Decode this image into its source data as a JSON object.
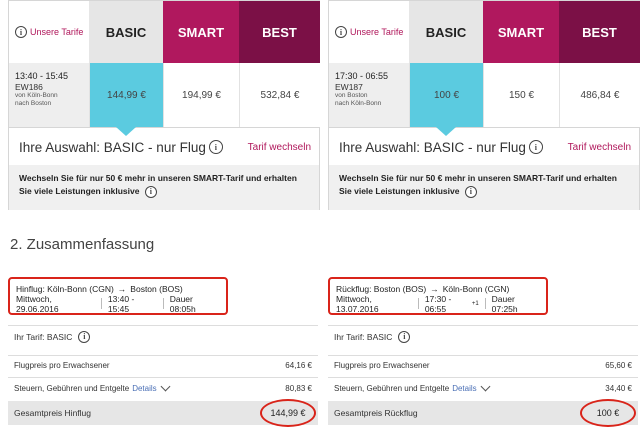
{
  "tariff_panels": [
    {
      "label": "Unsere Tarife",
      "tiers": [
        "BASIC",
        "SMART",
        "BEST"
      ],
      "flight_time": "13:40 - 15:45",
      "flight_number": "EW186",
      "route_line1": "von Köln-Bonn",
      "route_line2": "nach Boston",
      "prices": [
        "144,99 €",
        "194,99 €",
        "532,84 €"
      ],
      "selection": "Ihre Auswahl: BASIC - nur Flug",
      "change_link": "Tarif wechseln",
      "upsell": "Wechseln Sie für nur 50 € mehr in unseren SMART-Tarif und erhalten Sie viele Leistungen inklusive"
    },
    {
      "label": "Unsere Tarife",
      "tiers": [
        "BASIC",
        "SMART",
        "BEST"
      ],
      "flight_time": "17:30 - 06:55",
      "flight_number": "EW187",
      "route_line1": "von Boston",
      "route_line2": "nach Köln-Bonn",
      "prices": [
        "100 €",
        "150 €",
        "486,84 €"
      ],
      "selection": "Ihre Auswahl: BASIC - nur Flug",
      "change_link": "Tarif wechseln",
      "upsell": "Wechseln Sie für nur 50 € mehr in unseren SMART-Tarif und erhalten Sie viele Leistungen inklusive"
    }
  ],
  "section_title": "2. Zusammenfassung",
  "summaries": [
    {
      "route_prefix": "Hinflug: Köln-Bonn (CGN)",
      "arrow": "→",
      "destination": "Boston (BOS)",
      "date": "Mittwoch, 29.06.2016",
      "time": "13:40 - 15:45",
      "duration": "Dauer 08:05h",
      "tariff": "Ihr Tarif: BASIC",
      "price_label": "Flugpreis pro Erwachsener",
      "price_value": "64,16 €",
      "tax_label": "Steuern, Gebühren und Entgelte",
      "details_link": "Details",
      "tax_value": "80,83 €",
      "total_label": "Gesamtpreis Hinflug",
      "total_value": "144,99 €"
    },
    {
      "route_prefix": "Rückflug: Boston (BOS)",
      "arrow": "→",
      "destination": "Köln-Bonn (CGN)",
      "date": "Mittwoch, 13.07.2016",
      "time": "17:30 - 06:55",
      "time_sup": "+1",
      "duration": "Dauer 07:25h",
      "tariff": "Ihr Tarif: BASIC",
      "price_label": "Flugpreis pro Erwachsener",
      "price_value": "65,60 €",
      "tax_label": "Steuern, Gebühren und Entgelte",
      "details_link": "Details",
      "tax_value": "34,40 €",
      "total_label": "Gesamtpreis Rückflug",
      "total_value": "100 €"
    }
  ],
  "colors": {
    "basic_selected": "#5bcbe0",
    "smart": "#b0185e",
    "best": "#7b1046",
    "highlight_red": "#d9241a",
    "link": "#4a6fb5"
  }
}
